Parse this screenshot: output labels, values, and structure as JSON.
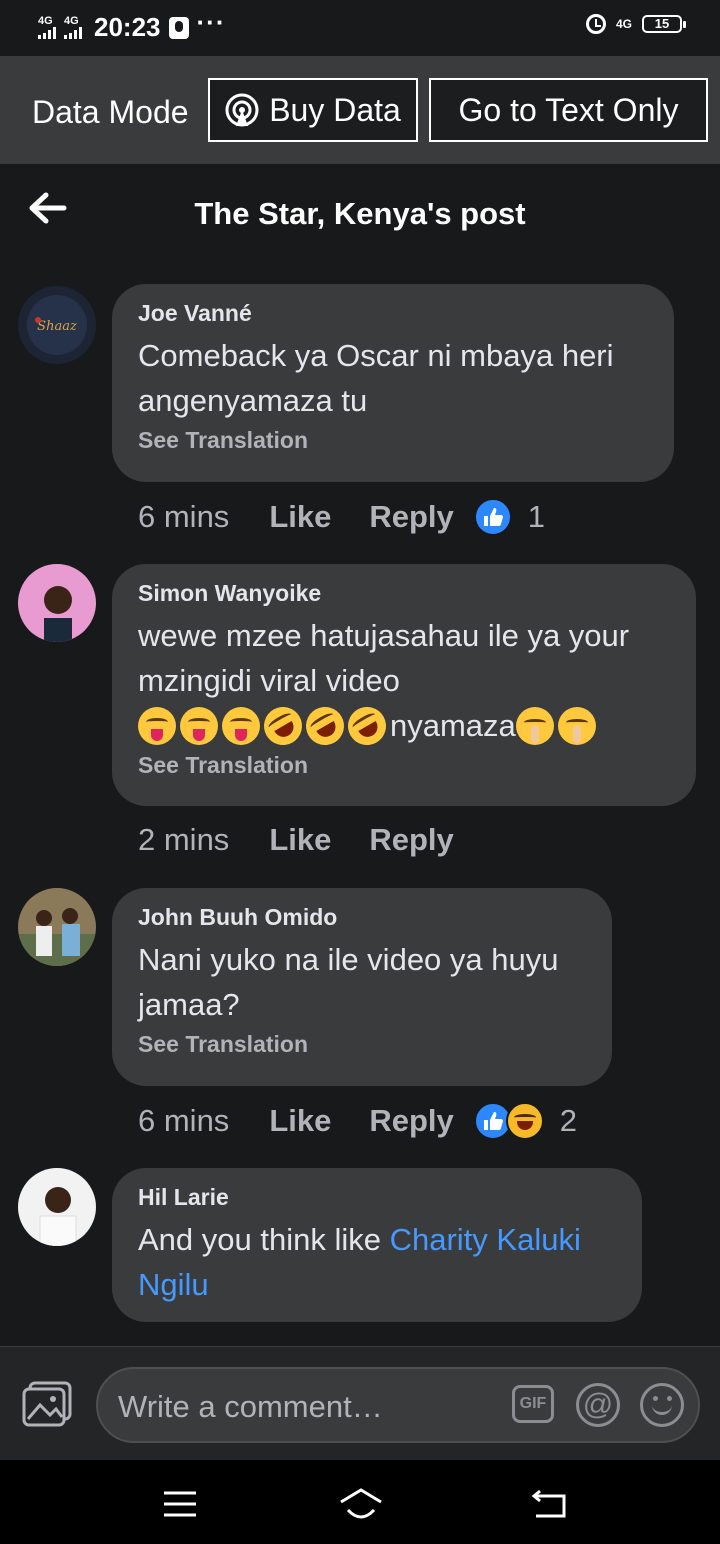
{
  "status_bar": {
    "network1": "4G",
    "network2": "4G",
    "time": "20:23",
    "more": "···",
    "network_right": "4G",
    "battery": "15"
  },
  "data_mode": {
    "label": "Data Mode",
    "buy_data": "Buy Data",
    "text_only": "Go to Text Only"
  },
  "header": {
    "title": "The Star, Kenya's post"
  },
  "comments": [
    {
      "author": "Joe Vanné",
      "text": "Comeback ya Oscar ni mbaya heri angenyamaza tu",
      "see_translation": "See Translation",
      "time": "6 mins",
      "like": "Like",
      "reply": "Reply",
      "reaction_count": "1"
    },
    {
      "author": "Simon Wanyoike",
      "text": "wewe mzee hatujasahau ile ya your mzingidi viral video",
      "text_tail": "nyamaza",
      "see_translation": "See Translation",
      "time": "2 mins",
      "like": "Like",
      "reply": "Reply"
    },
    {
      "author": "John Buuh Omido",
      "text": "Nani yuko na ile video ya huyu jamaa?",
      "see_translation": "See Translation",
      "time": "6 mins",
      "like": "Like",
      "reply": "Reply",
      "reaction_count": "2"
    },
    {
      "author": "Hil Larie",
      "text": "And you think like ",
      "mention": "Charity Kaluki Ngilu"
    }
  ],
  "composer": {
    "placeholder": "Write a comment…",
    "gif": "GIF",
    "at": "@"
  },
  "colors": {
    "background": "#18191a",
    "bubble": "#3a3b3c",
    "link": "#4599ff",
    "like_blue": "#2d88ff"
  }
}
